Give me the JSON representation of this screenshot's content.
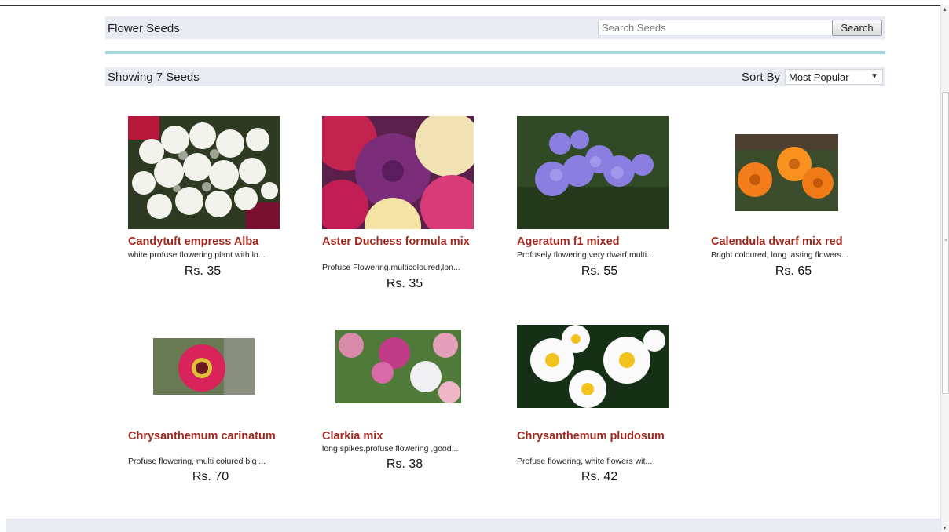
{
  "header": {
    "title": "Flower Seeds",
    "search_placeholder": "Search Seeds",
    "search_button": "Search"
  },
  "results": {
    "count_text": "Showing 7 Seeds",
    "sort_label": "Sort By",
    "sort_value": "Most Popular"
  },
  "products": [
    {
      "name": "Candytuft empress Alba",
      "description": "white profuse flowering plant with lo...",
      "price": "Rs. 35"
    },
    {
      "name": "Aster Duchess formula mix",
      "description": "Profuse Flowering,multicoloured,lon...",
      "price": "Rs. 35"
    },
    {
      "name": "Ageratum f1 mixed",
      "description": "Profusely flowering,very dwarf,multi...",
      "price": "Rs. 55"
    },
    {
      "name": "Calendula dwarf mix red",
      "description": "Bright coloured, long lasting flowers...",
      "price": "Rs. 65"
    },
    {
      "name": "Chrysanthemum carinatum",
      "description": "Profuse flowering, multi colured big ...",
      "price": "Rs. 70"
    },
    {
      "name": "Clarkia mix",
      "description": "long spikes,profuse flowering ,good...",
      "price": "Rs. 38"
    },
    {
      "name": "Chrysanthemum pludosum",
      "description": "Profuse flowering, white flowers wit...",
      "price": "Rs. 42"
    }
  ],
  "colors": {
    "product_name": "#a3271e",
    "accent_line": "#9fd6de",
    "bar_background": "#e8ecf2"
  }
}
